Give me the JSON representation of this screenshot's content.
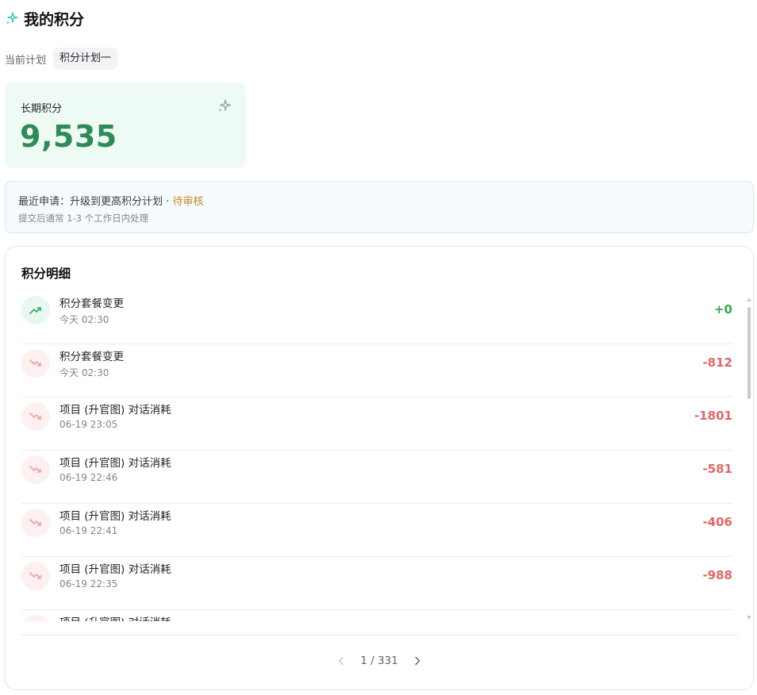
{
  "header": {
    "title": "我的积分",
    "icon": "sparkle-icon"
  },
  "plan": {
    "label": "当前计划",
    "value": "积分计划一"
  },
  "points": {
    "label": "长期积分",
    "value": "9,535"
  },
  "banner": {
    "prefix": "最近申请：",
    "request": "升级到更高积分计划",
    "separator": " · ",
    "status": "待审核",
    "note": "提交后通常 1-3 个工作日内处理"
  },
  "detail": {
    "title": "积分明细",
    "items": [
      {
        "name": "积分套餐变更",
        "time": "今天 02:30",
        "amount": "+0",
        "trend": "up"
      },
      {
        "name": "积分套餐变更",
        "time": "今天 02:30",
        "amount": "-812",
        "trend": "down"
      },
      {
        "name": "项目 (升官图) 对话消耗",
        "time": "06-19 23:05",
        "amount": "-1801",
        "trend": "down"
      },
      {
        "name": "项目 (升官图) 对话消耗",
        "time": "06-19 22:46",
        "amount": "-581",
        "trend": "down"
      },
      {
        "name": "项目 (升官图) 对话消耗",
        "time": "06-19 22:41",
        "amount": "-406",
        "trend": "down"
      },
      {
        "name": "项目 (升官图) 对话消耗",
        "time": "06-19 22:35",
        "amount": "-988",
        "trend": "down"
      },
      {
        "name": "项目 (升官图) 对话消耗",
        "time": "",
        "amount": "",
        "trend": "down"
      }
    ]
  },
  "pager": {
    "current": "1",
    "total": "331",
    "text": "1 / 331"
  },
  "colors": {
    "positive": "#34a853",
    "negative": "#e06666",
    "accent": "#2e8b57",
    "pending": "#c78a1e"
  }
}
